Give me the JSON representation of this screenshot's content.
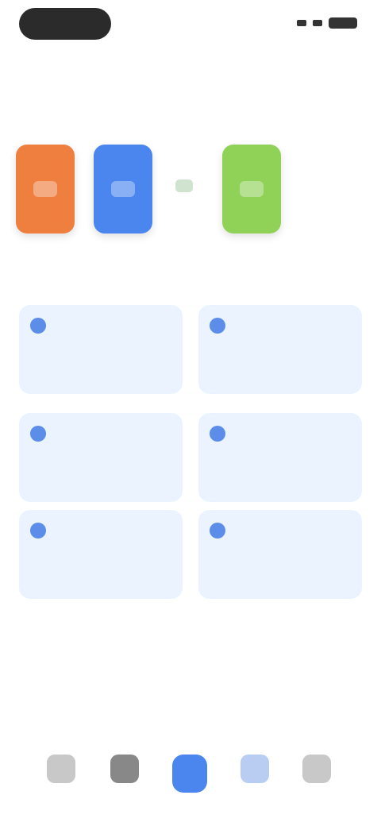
{
  "status_bar": {
    "time": "",
    "icons": [
      "signal-icon",
      "wifi-icon",
      "battery-icon"
    ]
  },
  "page": {
    "title": ""
  },
  "categories": [
    {
      "label": "",
      "color": "#ef7f3f"
    },
    {
      "label": "",
      "color": "#4b86ee"
    },
    {
      "label": "",
      "color": "#d7ebd7"
    },
    {
      "label": "",
      "color": "#90d258"
    }
  ],
  "section": {
    "title": "",
    "more": ""
  },
  "cards": [
    {
      "title": "",
      "subtitle": ""
    },
    {
      "title": "",
      "subtitle": ""
    },
    {
      "title": "",
      "subtitle": ""
    },
    {
      "title": "",
      "subtitle": ""
    },
    {
      "title": "",
      "subtitle": ""
    },
    {
      "title": "",
      "subtitle": ""
    }
  ],
  "blocks": {
    "block1_title": "",
    "block2_title": ""
  },
  "tabbar": {
    "items": [
      {
        "label": "",
        "icon": "home-icon",
        "active": false
      },
      {
        "label": "",
        "icon": "grid-icon",
        "active": false
      },
      {
        "label": "",
        "icon": "center-icon",
        "active": true
      },
      {
        "label": "",
        "icon": "message-icon",
        "active": false
      },
      {
        "label": "",
        "icon": "profile-icon",
        "active": false
      }
    ]
  },
  "colors": {
    "accent": "#4b86ee",
    "card_bg": "#eaf3ff"
  }
}
